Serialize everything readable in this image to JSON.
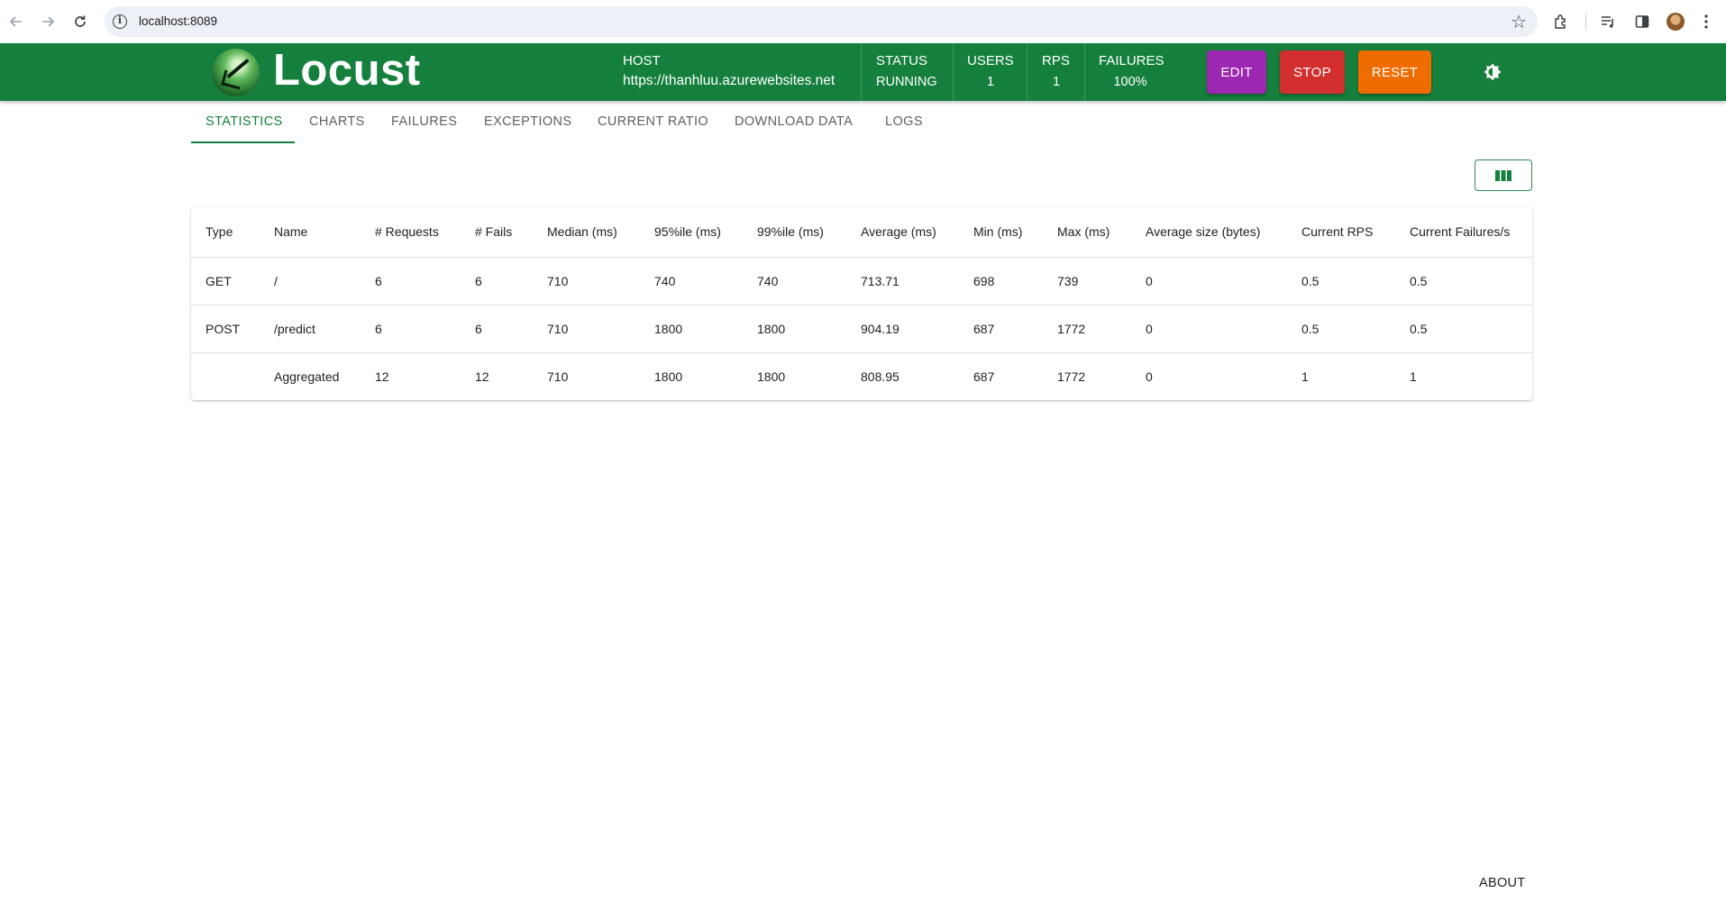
{
  "browser": {
    "url": "localhost:8089",
    "icons": [
      "back-arrow-icon",
      "forward-arrow-icon",
      "reload-icon",
      "site-info-icon",
      "bookmark-star-icon",
      "extensions-icon",
      "media-controls-icon",
      "side-panel-icon",
      "profile-avatar",
      "menu-dots-icon"
    ]
  },
  "header": {
    "brand": "Locust",
    "host_label": "HOST",
    "host_value": "https://thanhluu.azurewebsites.net",
    "status_label": "STATUS",
    "status_value": "RUNNING",
    "users_label": "USERS",
    "users_value": "1",
    "rps_label": "RPS",
    "rps_value": "1",
    "failures_label": "FAILURES",
    "failures_value": "100%",
    "edit_label": "EDIT",
    "stop_label": "STOP",
    "reset_label": "RESET",
    "colors": {
      "bar": "#15803d",
      "edit": "#9c27b0",
      "stop": "#d32f2f",
      "reset": "#ef6c00"
    }
  },
  "tabs": [
    {
      "label": "STATISTICS",
      "active": true
    },
    {
      "label": "CHARTS"
    },
    {
      "label": "FAILURES"
    },
    {
      "label": "EXCEPTIONS"
    },
    {
      "label": "CURRENT RATIO"
    },
    {
      "label": "DOWNLOAD DATA"
    },
    {
      "label": "LOGS"
    }
  ],
  "table": {
    "columns": [
      "Type",
      "Name",
      "# Requests",
      "# Fails",
      "Median (ms)",
      "95%ile (ms)",
      "99%ile (ms)",
      "Average (ms)",
      "Min (ms)",
      "Max (ms)",
      "Average size (bytes)",
      "Current RPS",
      "Current Failures/s"
    ],
    "rows": [
      [
        "GET",
        "/",
        "6",
        "6",
        "710",
        "740",
        "740",
        "713.71",
        "698",
        "739",
        "0",
        "0.5",
        "0.5"
      ],
      [
        "POST",
        "/predict",
        "6",
        "6",
        "710",
        "1800",
        "1800",
        "904.19",
        "687",
        "1772",
        "0",
        "0.5",
        "0.5"
      ],
      [
        "",
        "Aggregated",
        "12",
        "12",
        "710",
        "1800",
        "1800",
        "808.95",
        "687",
        "1772",
        "0",
        "1",
        "1"
      ]
    ]
  },
  "footer": {
    "about": "ABOUT"
  }
}
